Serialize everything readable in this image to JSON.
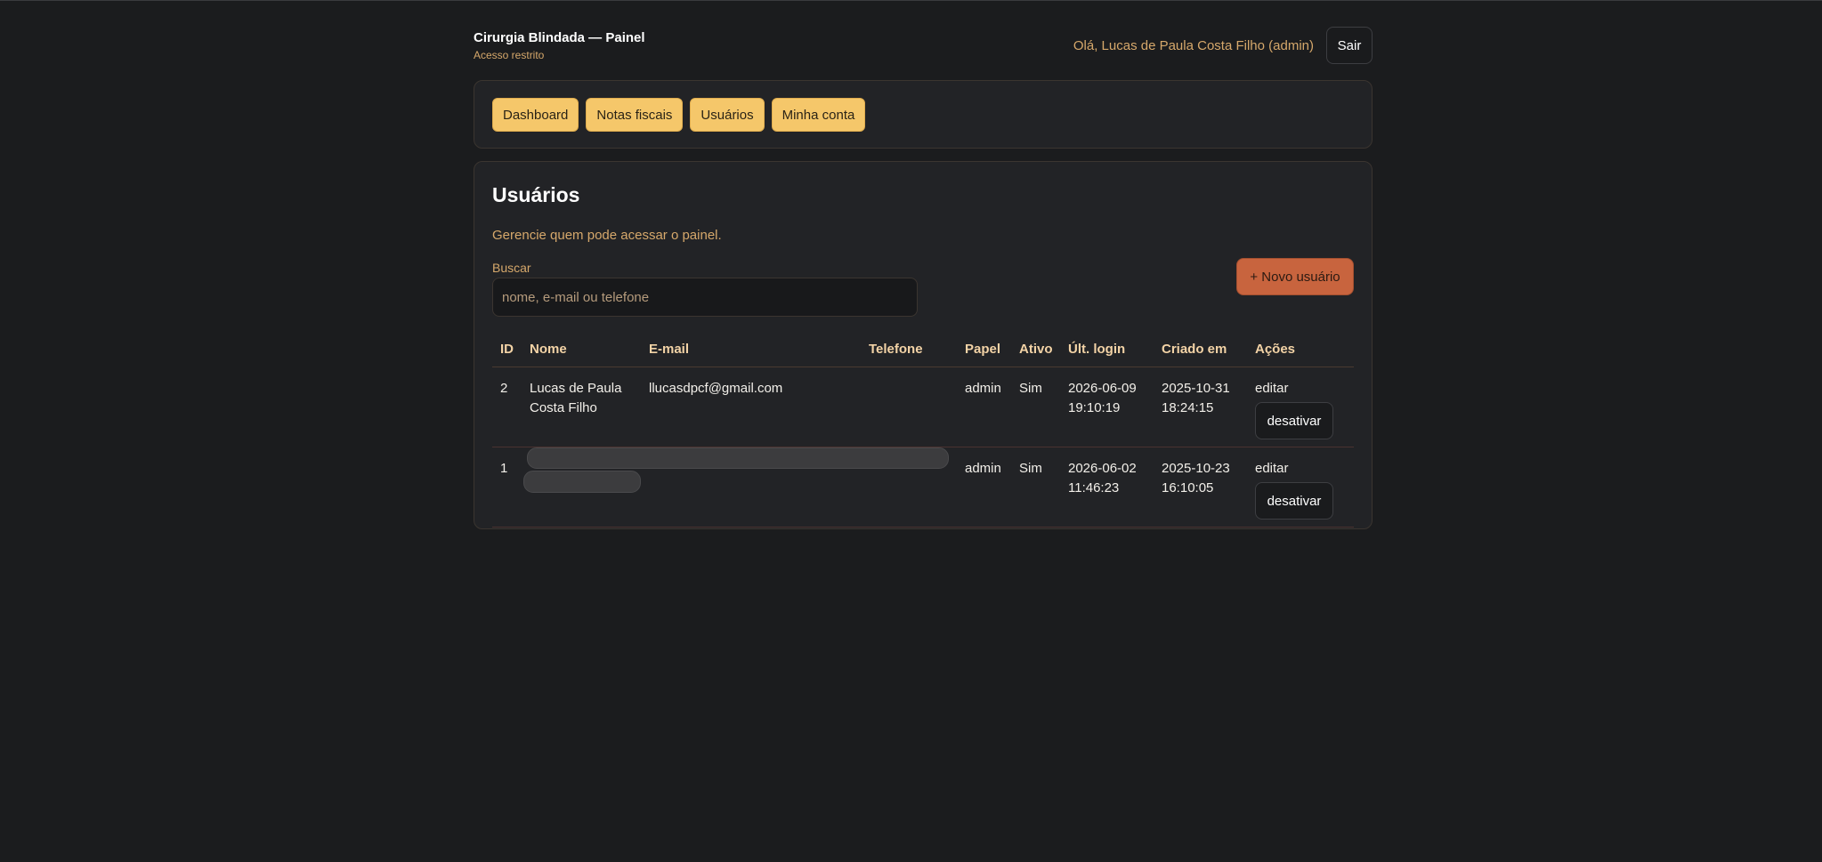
{
  "header": {
    "title": "Cirurgia Blindada — Painel",
    "subtitle": "Acesso restrito",
    "greeting": "Olá, Lucas de Paula Costa Filho (admin)",
    "logout_label": "Sair"
  },
  "nav": {
    "tabs": [
      {
        "label": "Dashboard"
      },
      {
        "label": "Notas fiscais"
      },
      {
        "label": "Usuários"
      },
      {
        "label": "Minha conta"
      }
    ]
  },
  "users": {
    "title": "Usuários",
    "description": "Gerencie quem pode acessar o painel.",
    "search_label": "Buscar",
    "search_placeholder": "nome, e-mail ou telefone",
    "search_value": "",
    "new_user_label": "+ Novo usuário",
    "columns": [
      "ID",
      "Nome",
      "E-mail",
      "Telefone",
      "Papel",
      "Ativo",
      "Últ. login",
      "Criado em",
      "Ações"
    ],
    "rows": [
      {
        "id": "2",
        "name": "Lucas de Paula Costa Filho",
        "email": "llucasdpcf@gmail.com",
        "phone": "",
        "role": "admin",
        "active": "Sim",
        "last_login": "2026-06-09 19:10:19",
        "created_at": "2025-10-31 18:24:15",
        "edit_label": "editar",
        "deactivate_label": "desativar"
      },
      {
        "id": "1",
        "name": "",
        "email": "",
        "phone": "",
        "role": "admin",
        "active": "Sim",
        "last_login": "2026-06-02 11:46:23",
        "created_at": "2025-10-23 16:10:05",
        "edit_label": "editar",
        "deactivate_label": "desativar"
      }
    ]
  }
}
